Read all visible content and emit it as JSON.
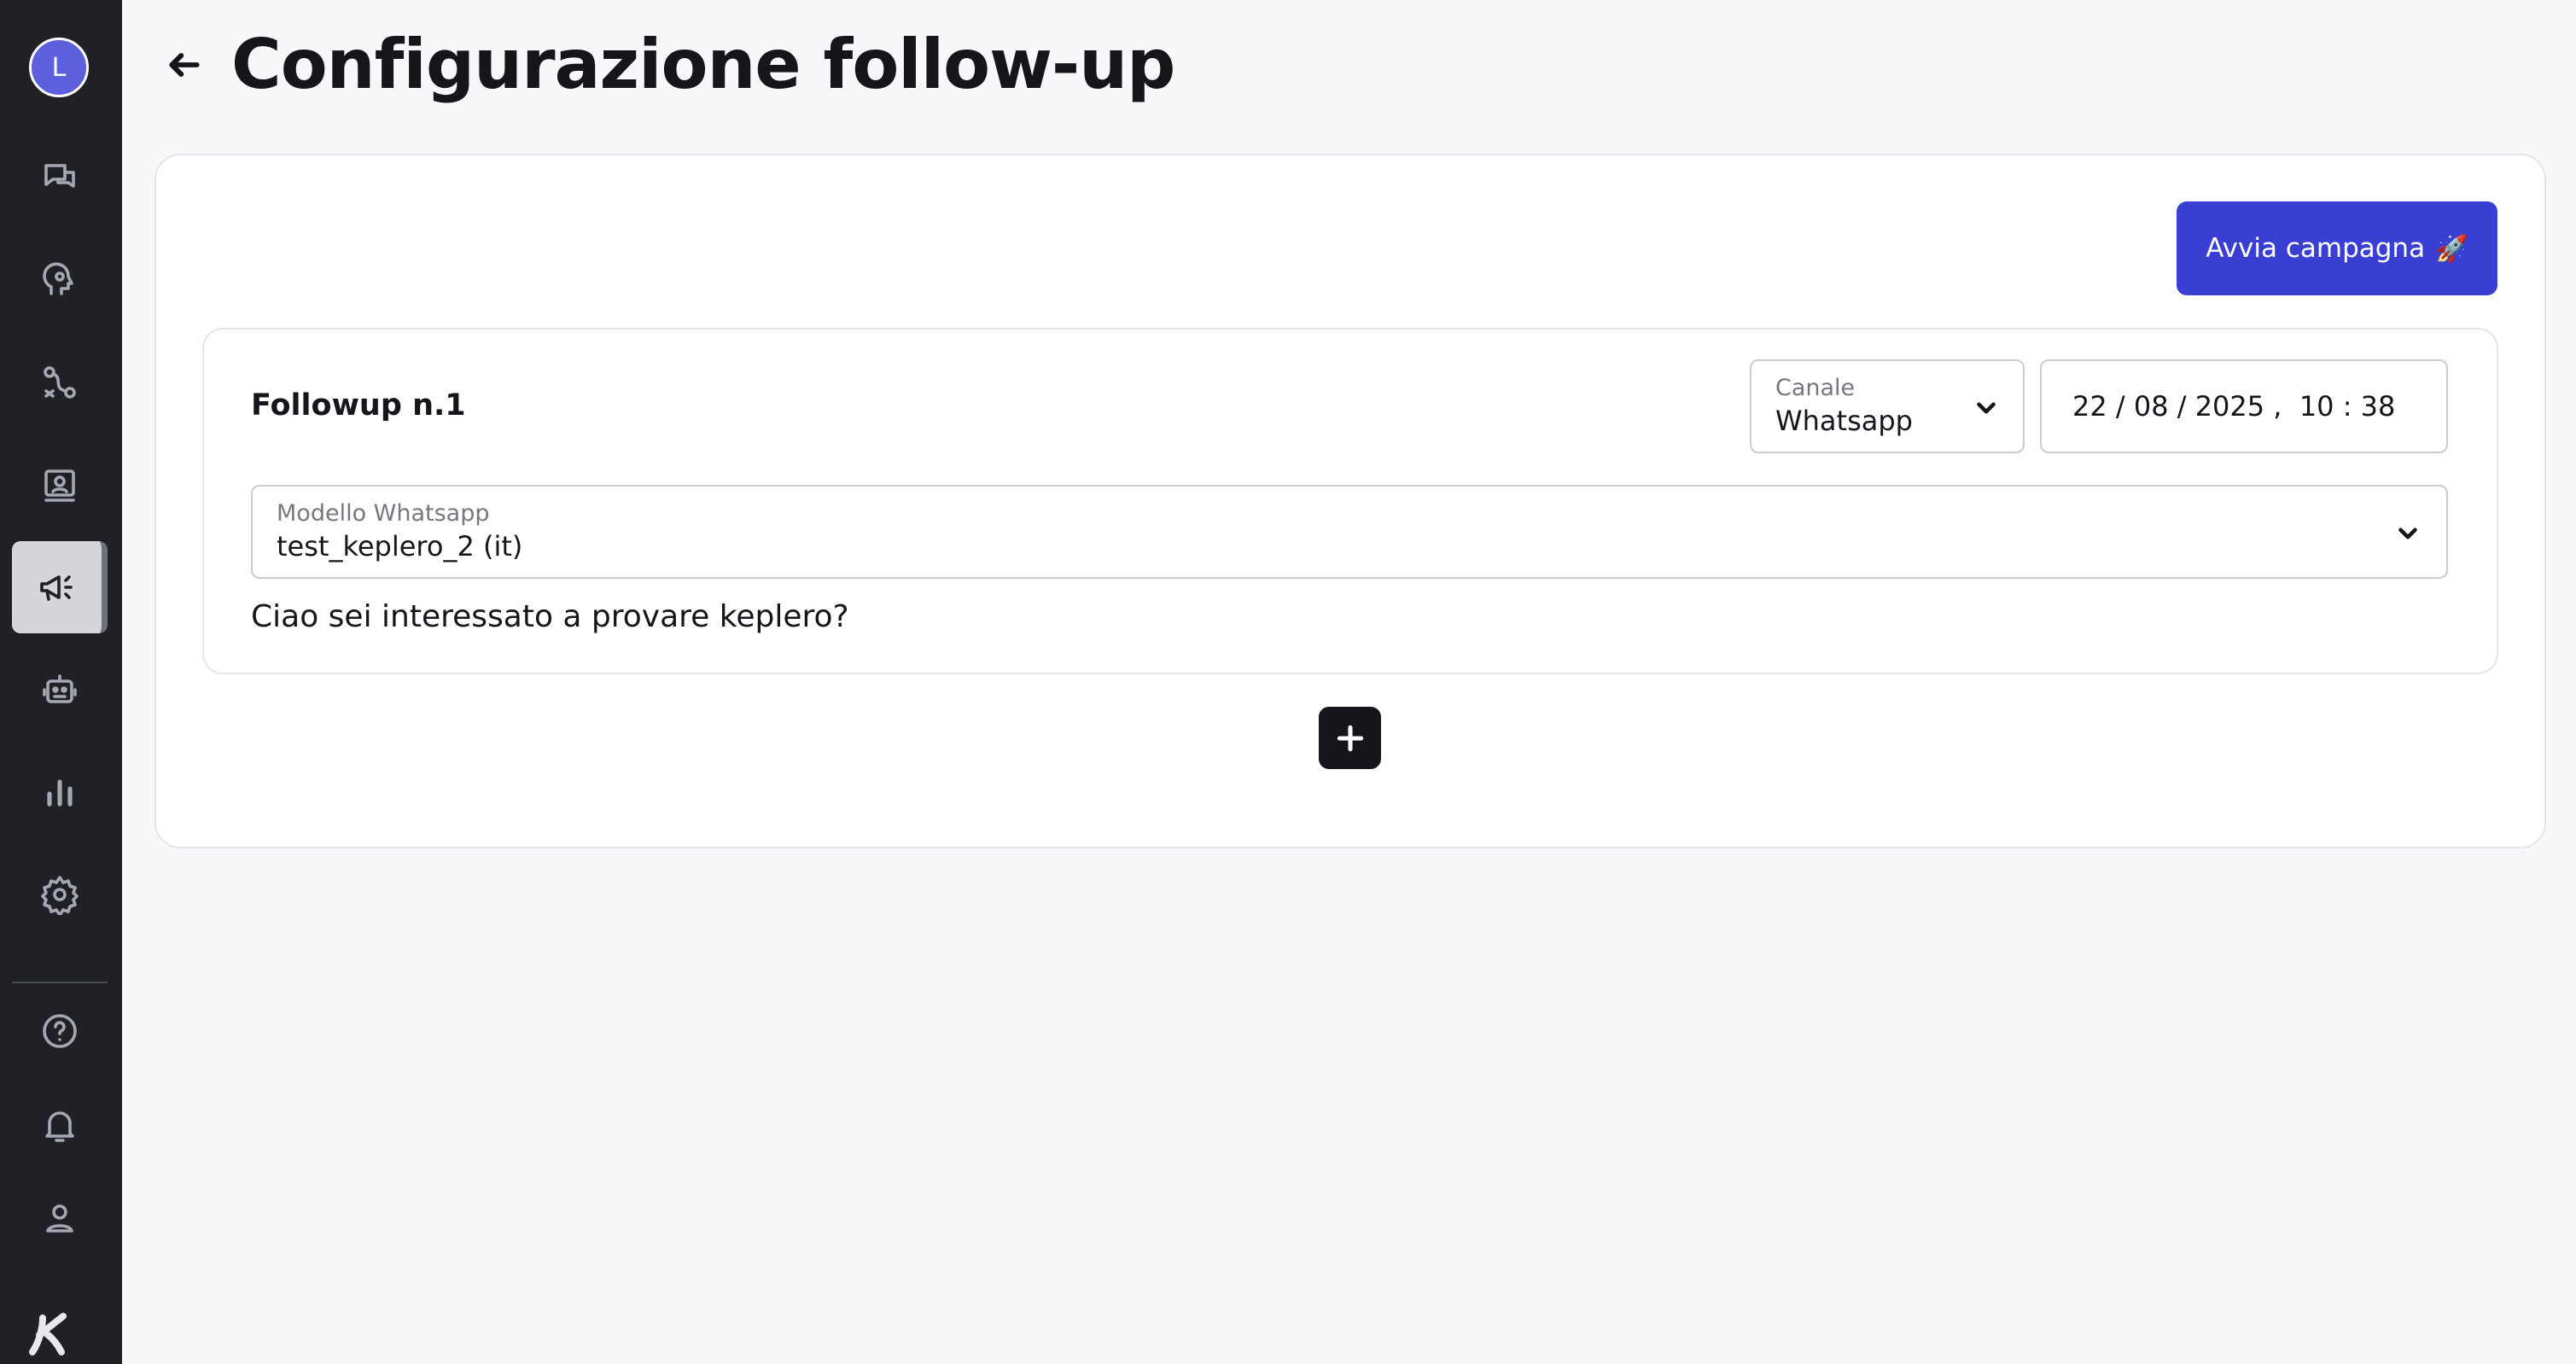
{
  "user": {
    "avatar_initial": "L"
  },
  "sidebar": {
    "items": [
      {
        "icon": "chat-icon",
        "active": false
      },
      {
        "icon": "head-gear-icon",
        "active": false
      },
      {
        "icon": "route-icon",
        "active": false
      },
      {
        "icon": "contacts-icon",
        "active": false
      },
      {
        "icon": "megaphone-icon",
        "active": true
      },
      {
        "icon": "robot-icon",
        "active": false
      },
      {
        "icon": "bar-chart-icon",
        "active": false
      },
      {
        "icon": "gear-icon",
        "active": false
      }
    ],
    "bottom_items": [
      {
        "icon": "help-icon"
      },
      {
        "icon": "bell-icon"
      },
      {
        "icon": "user-icon"
      }
    ],
    "logo_icon": "brand-logo-icon"
  },
  "header": {
    "title": "Configurazione follow-up",
    "back_icon": "arrow-left-icon"
  },
  "actions": {
    "launch_label": "Avvia campagna",
    "launch_emoji": "🚀"
  },
  "followup": {
    "title": "Followup n.1",
    "channel": {
      "label": "Canale",
      "value": "Whatsapp"
    },
    "datetime": "22 / 08 / 2025 ,  10 : 38",
    "template": {
      "label": "Modello Whatsapp",
      "value": "test_keplero_2 (it)"
    },
    "message": "Ciao sei interessato a provare keplero?"
  },
  "add_icon": "plus-icon",
  "colors": {
    "sidebar_bg": "#1f2127",
    "accent": "#3a3fd4",
    "avatar": "#5c60dc",
    "page_bg": "#f7f8fa"
  }
}
